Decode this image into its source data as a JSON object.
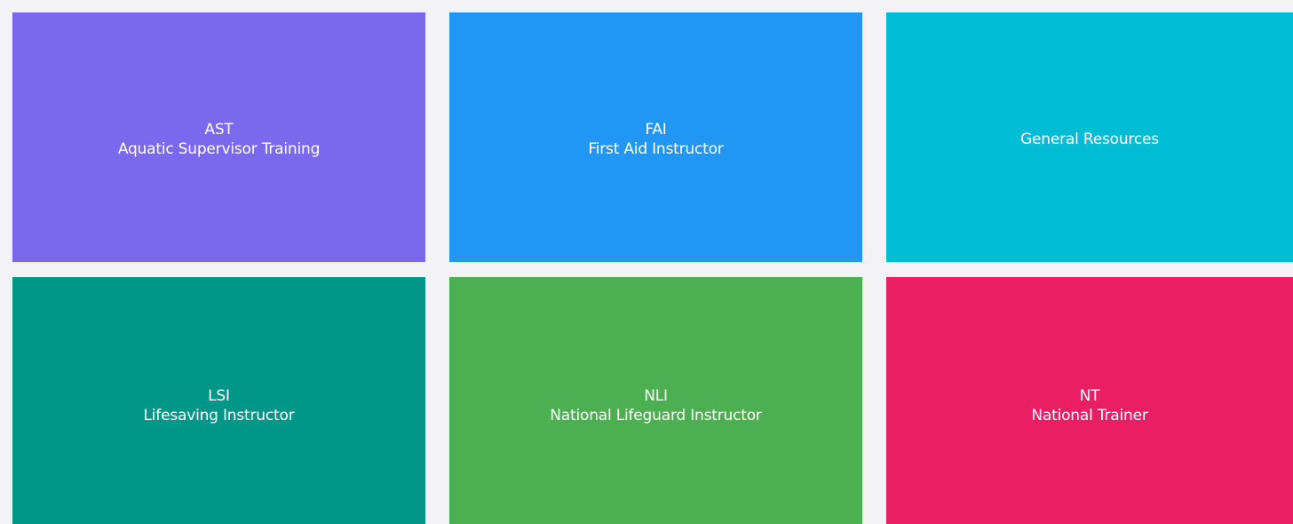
{
  "tiles": [
    {
      "code": "AST",
      "title": "Aquatic Supervisor Training",
      "color": "#7b68ee"
    },
    {
      "code": "FAI",
      "title": "First Aid Instructor",
      "color": "#2196f3"
    },
    {
      "code": "",
      "title": "General Resources",
      "color": "#00bcd4"
    },
    {
      "code": "LSI",
      "title": "Lifesaving Instructor",
      "color": "#009688"
    },
    {
      "code": "NLI",
      "title": "National Lifeguard Instructor",
      "color": "#4caf50"
    },
    {
      "code": "NT",
      "title": "National Trainer",
      "color": "#e91e63"
    }
  ]
}
